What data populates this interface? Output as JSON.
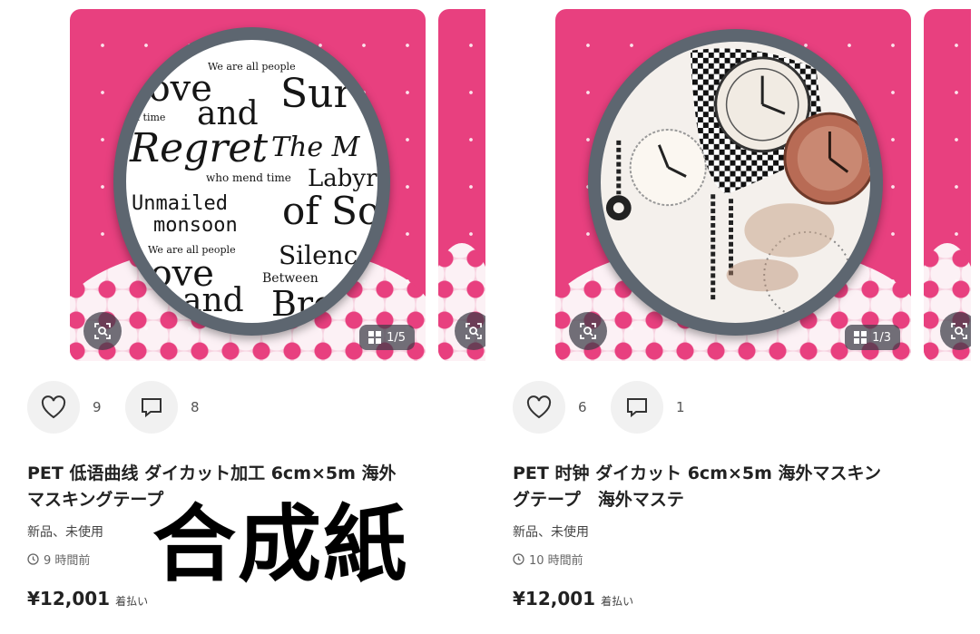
{
  "items": [
    {
      "image_counter": "1/5",
      "likes": "9",
      "comments": "8",
      "title_line1": "PET 低语曲线 ダイカット加工 6cm×5m 海外",
      "title_line2": "マスキングテープ",
      "condition": "新品、未使用",
      "posted": "9 時間前",
      "price": "¥12,001",
      "shipping": "着払い",
      "tape_text": {
        "t1": "We are all people",
        "t2": "Love",
        "t3": "Sur",
        "t4": "d time",
        "t5": "and",
        "t6": "Regret",
        "t7": "The M",
        "t8": "who mend time",
        "t9": "Labyr",
        "t10": "Unmailed",
        "t11": "monsoon",
        "t12": "of Sou",
        "t13": "We are all people",
        "t14": "Love",
        "t15": "Silence",
        "t16": "Between",
        "t17": "and",
        "t18": "Bre"
      }
    },
    {
      "image_counter": "1/3",
      "likes": "6",
      "comments": "1",
      "title_line1": "PET 时钟 ダイカット 6cm×5m 海外マスキン",
      "title_line2": "グテープ　海外マステ",
      "condition": "新品、未使用",
      "posted": "10 時間前",
      "price": "¥12,001",
      "shipping": "着払い"
    }
  ],
  "overlay_text": "合成紙",
  "colors": {
    "card_bg": "#e8407f",
    "tape_rim": "#5d6670",
    "button_bg": "#f1f1f1"
  }
}
